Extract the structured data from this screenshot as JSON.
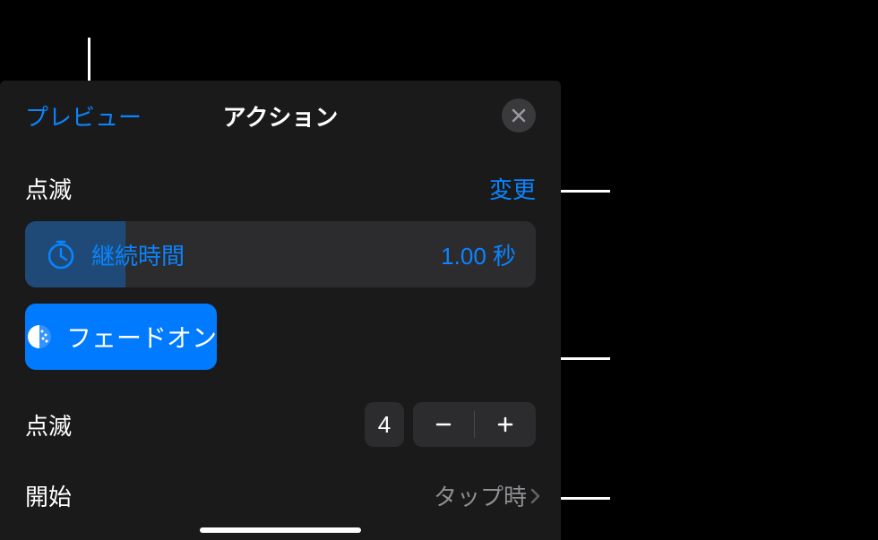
{
  "header": {
    "preview_label": "プレビュー",
    "title": "アクション"
  },
  "section": {
    "effect_name": "点滅",
    "change_label": "変更"
  },
  "duration": {
    "label": "継続時間",
    "value": "1.00 秒"
  },
  "fade": {
    "label": "フェードオン"
  },
  "stepper": {
    "label": "点滅",
    "value": "4"
  },
  "start": {
    "label": "開始",
    "value": "タップ時"
  },
  "icons": {
    "close": "close-icon",
    "timer": "timer-icon",
    "fade": "fade-icon",
    "minus": "minus-icon",
    "plus": "plus-icon",
    "chevron": "chevron-right-icon"
  }
}
